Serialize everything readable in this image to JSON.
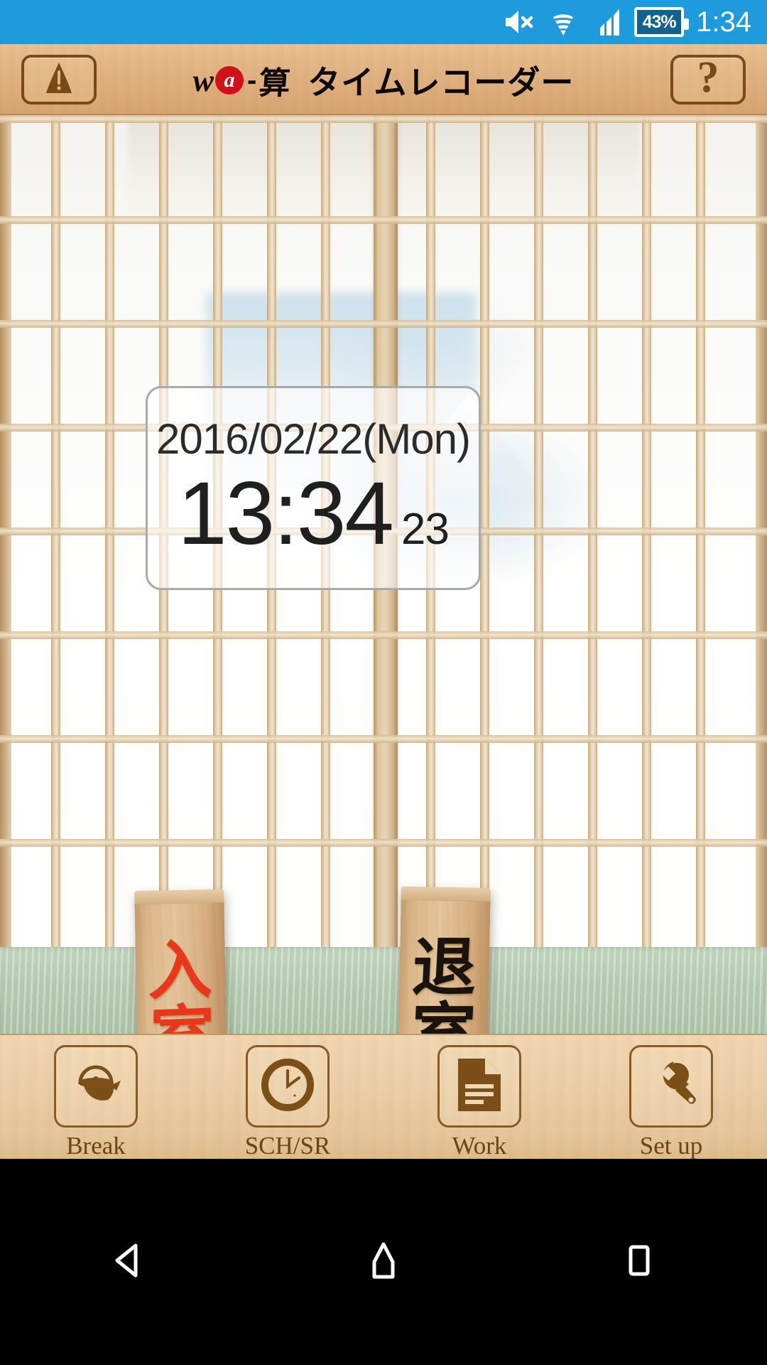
{
  "status_bar": {
    "background_color": "#1e9bdc",
    "mute_icon": "volume-mute-icon",
    "wifi_icon": "wifi-icon",
    "signal_icon": "cellular-signal-icon",
    "battery_percent": "43%",
    "clock": "1:34"
  },
  "app_header": {
    "background_color": "#e3b585",
    "warning_button_icon": "warning-triangle-icon",
    "help_button_label": "?",
    "logo": {
      "mark_w": "w",
      "mark_a": "a",
      "mark_dash": "-",
      "mark_kanji": "算"
    },
    "title": "タイムレコーダー"
  },
  "clock_panel": {
    "date": "2016/02/22(Mon)",
    "time": "13:34",
    "seconds": "23"
  },
  "stamp_buttons": [
    {
      "name": "clock-in",
      "char_top": "入",
      "char_bottom": "室",
      "color": "#e8371a"
    },
    {
      "name": "clock-out",
      "char_top": "退",
      "char_bottom": "室",
      "color": "#19130c"
    }
  ],
  "toolbar": {
    "items": [
      {
        "label": "Break",
        "icon": "teapot-icon"
      },
      {
        "label": "SCH/SR",
        "icon": "clock-icon"
      },
      {
        "label": "Work",
        "icon": "document-icon"
      },
      {
        "label": "Set up",
        "icon": "wrench-icon"
      }
    ]
  },
  "android_nav": {
    "back_icon": "back-triangle-icon",
    "home_icon": "home-pentagon-icon",
    "recents_icon": "recents-square-icon"
  }
}
